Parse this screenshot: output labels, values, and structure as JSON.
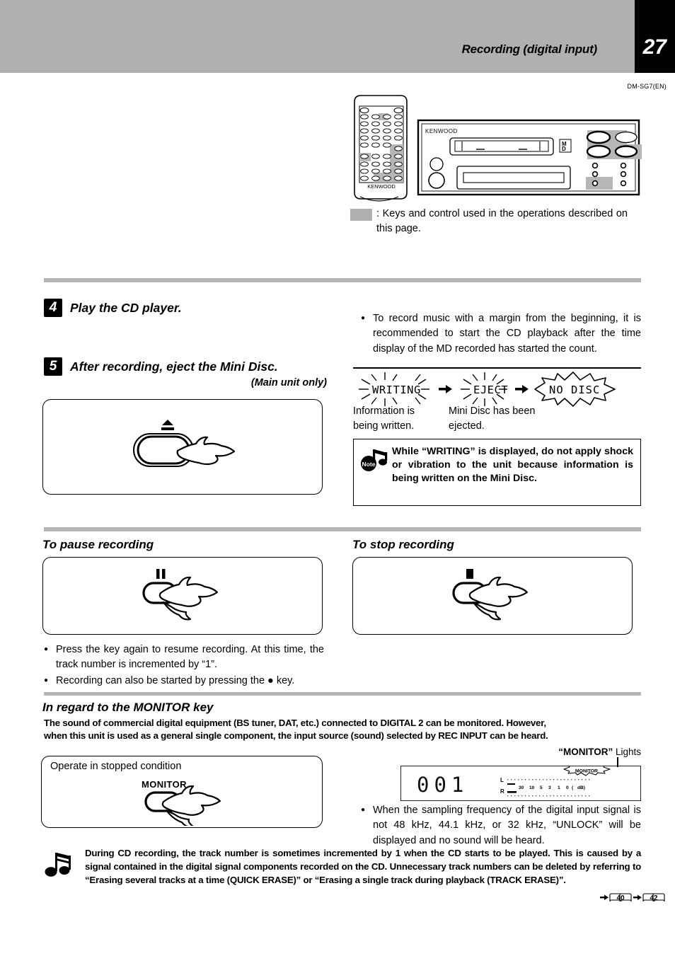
{
  "header": {
    "title": "Recording (digital input)",
    "page_number": "27",
    "model_code": "DM-SG7(EN)"
  },
  "legend": {
    "text": ": Keys and control used in the operations described on this page."
  },
  "device": {
    "brand": "KENWOOD",
    "remote_brand": "KENWOOD",
    "disc_label_line1": "M",
    "disc_label_line2": "D"
  },
  "steps": [
    {
      "number": "4",
      "title": "Play the CD player.",
      "subtitle": ""
    },
    {
      "number": "5",
      "title": "After recording, eject the Mini Disc.",
      "subtitle": "(Main unit only)"
    }
  ],
  "step4_bullets": [
    "To record music with a margin from the beginning, it is recommended to start the CD playback after the time display of the MD recorded has started the count."
  ],
  "display_sequence": {
    "items": [
      {
        "text": "WRITING",
        "style": "blink",
        "caption": "Information is being written."
      },
      {
        "text": "EJECT",
        "style": "blink",
        "caption": "Mini Disc has been ejected."
      },
      {
        "text": "NO DISC",
        "style": "burst",
        "caption": ""
      }
    ],
    "arrow": "→"
  },
  "note_writing": {
    "badge": "Note",
    "text": "While “WRITING” is displayed, do not apply shock or vibration to the unit because information is being written on the Mini Disc."
  },
  "pause_section": {
    "heading": "To pause recording",
    "key_glyph": "pause"
  },
  "stop_section": {
    "heading": "To stop recording",
    "key_glyph": "stop"
  },
  "pause_bullets": [
    "Press the key again to resume recording. At this time, the track number is incremented by “1”.",
    "Recording can also be started by pressing the ● key."
  ],
  "monitor_section": {
    "heading": "In regard to the MONITOR key",
    "paragraph_line1": "The sound of commercial digital equipment (BS tuner, DAT, etc.) connected to DIGITAL 2 can be monitored. However,",
    "paragraph_line2": "when this unit is used as a general single component, the input source (sound) selected by REC INPUT can be heard.",
    "figure_caption": "Operate in stopped condition",
    "key_label": "MONITOR",
    "lights_label_quoted": "“MONITOR”",
    "lights_label_rest": " Lights",
    "display": {
      "digits": "001",
      "channel_left": "L",
      "channel_right": "R",
      "scale": [
        "30",
        "10",
        "5",
        "3",
        "1",
        "0",
        "(",
        "dB)"
      ],
      "indicator": "MONITOR"
    },
    "bullets": [
      "When the sampling frequency of the digital input signal is not 48 kHz, 44.1 kHz, or 32 kHz, “UNLOCK” will be displayed and no sound will be heard."
    ],
    "bullet_bold_part": "“UNLOCK”"
  },
  "bottom_note": {
    "text": "During CD recording, the track number is sometimes incremented by 1 when the CD starts to be played. This is caused by a signal contained in the digital signal components recorded on the CD. Unnecessary track numbers can be deleted by referring to “Erasing several tracks at a time (QUICK ERASE)” or “Erasing a single track during playback (TRACK ERASE)”.",
    "page_refs": [
      "40",
      "42"
    ],
    "arrow": "→"
  },
  "colors": {
    "header_band": "#b0b0b0",
    "page_tab": "#000000",
    "highlight": "#b0b0b0",
    "rule_grey": "#b5b5b5"
  }
}
